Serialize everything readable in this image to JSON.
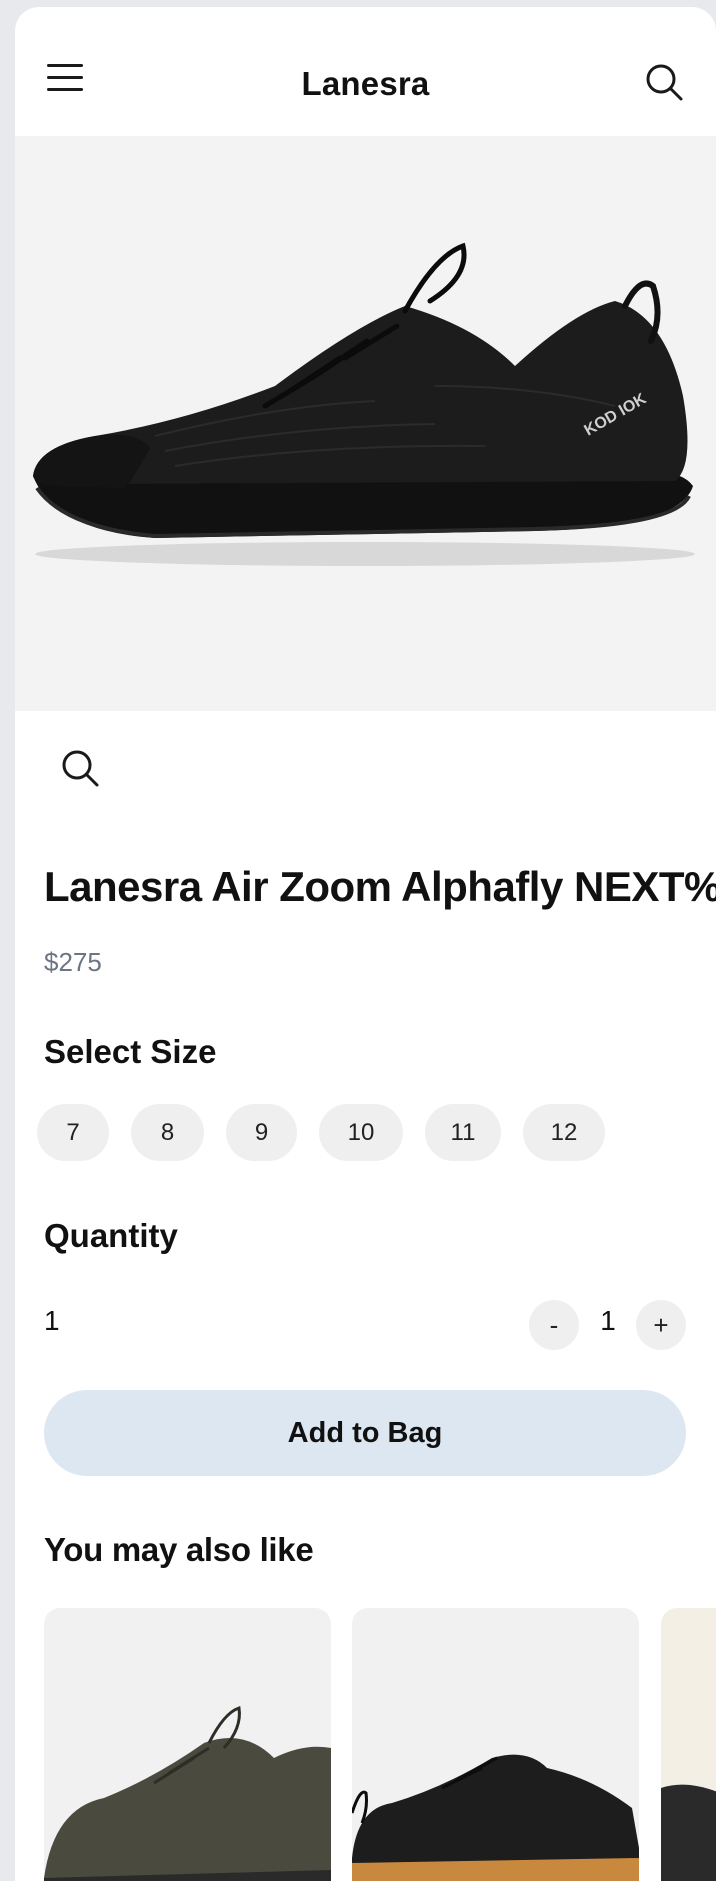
{
  "header": {
    "brand": "Lanesra",
    "menu_icon": "hamburger-menu-icon",
    "search_icon": "search-icon"
  },
  "hero": {
    "image": "black running shoe side view",
    "logo_text": "KOD IOK",
    "zoom_icon": "magnifier-icon"
  },
  "product": {
    "title": "Lanesra Air Zoom Alphafly NEXT%",
    "price": "$275"
  },
  "size_section": {
    "label": "Select Size",
    "sizes": [
      "7",
      "8",
      "9",
      "10",
      "11",
      "12"
    ]
  },
  "quantity_section": {
    "label": "Quantity",
    "value": "1",
    "stepper": {
      "minus": "-",
      "value": "1",
      "plus": "+"
    }
  },
  "add_to_bag": "Add to Bag",
  "recommendations": {
    "label": "You may also like",
    "items": [
      {
        "image": "olive green running shoe"
      },
      {
        "image": "black running shoe with gum sole"
      },
      {
        "image": "dark running shoe on cream background"
      }
    ]
  },
  "colors": {
    "button_bg": "#dde7f1",
    "chip_bg": "#efefef",
    "price": "#6b7685",
    "page_bg": "#e8e9ec"
  }
}
